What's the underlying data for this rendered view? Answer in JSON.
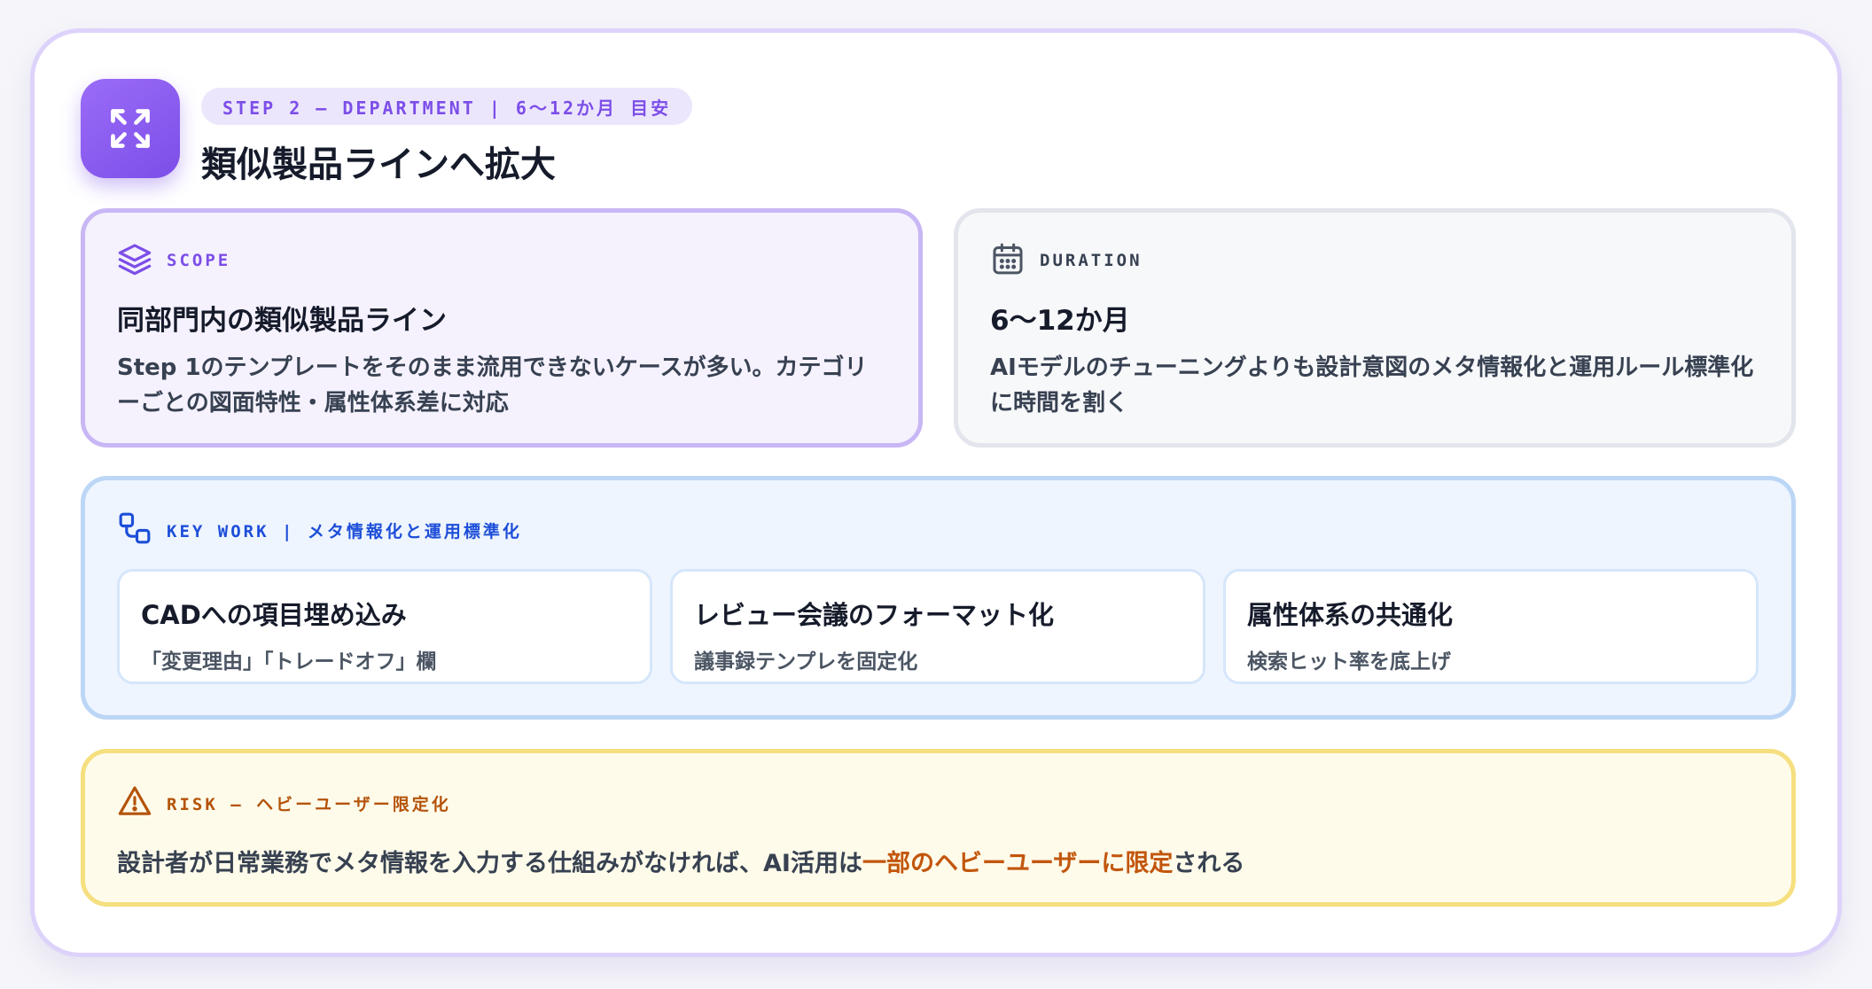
{
  "colors": {
    "accent_purple": "#7c4ee8",
    "key_blue": "#1d4ed8",
    "risk_orange": "#b45309",
    "risk_emphasis": "#c2560c"
  },
  "header": {
    "icon": "expand-arrows-icon",
    "step_label": "STEP 2 – DEPARTMENT | 6〜12か月 目安",
    "title": "類似製品ラインへ拡大"
  },
  "scope": {
    "icon": "layers-icon",
    "label": "SCOPE",
    "heading": "同部門内の類似製品ライン",
    "body": "Step 1のテンプレートをそのまま流用できないケースが多い。カテゴリーごとの図面特性・属性体系差に対応"
  },
  "duration": {
    "icon": "calendar-icon",
    "label": "DURATION",
    "heading": "6〜12か月",
    "body": "AIモデルのチューニングよりも設計意図のメタ情報化と運用ルール標準化に時間を割く"
  },
  "key_work": {
    "icon": "workflow-icon",
    "label": "KEY WORK | メタ情報化と運用標準化",
    "items": [
      {
        "title": "CADへの項目埋め込み",
        "subtitle": "「変更理由」「トレードオフ」欄"
      },
      {
        "title": "レビュー会議のフォーマット化",
        "subtitle": "議事録テンプレを固定化"
      },
      {
        "title": "属性体系の共通化",
        "subtitle": "検索ヒット率を底上げ"
      }
    ]
  },
  "risk": {
    "icon": "warning-triangle-icon",
    "label": "RISK – ヘビーユーザー限定化",
    "text_before": "設計者が日常業務でメタ情報を入力する仕組みがなければ、AI活用は",
    "text_emphasis": "一部のヘビーユーザーに限定",
    "text_after": "される"
  }
}
